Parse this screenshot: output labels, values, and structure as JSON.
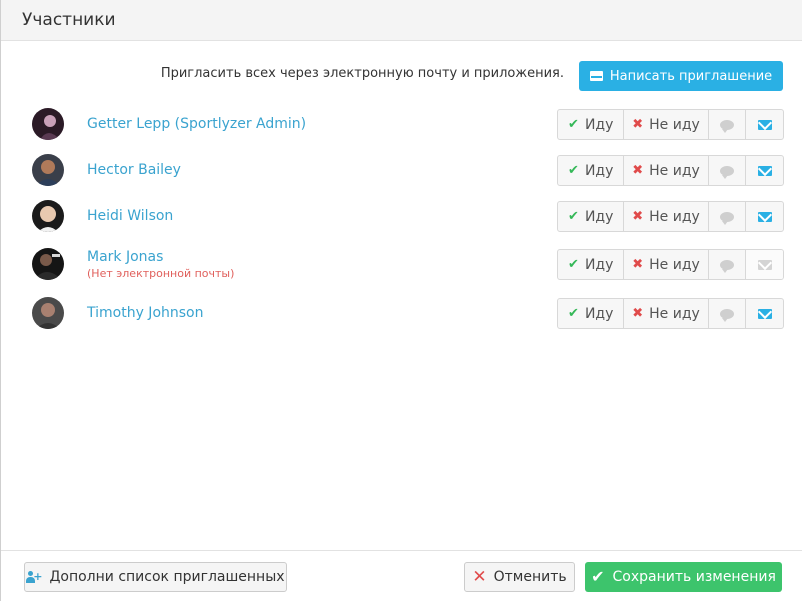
{
  "modal": {
    "title": "Участники"
  },
  "invite": {
    "text": "Пригласить всех через электронную почту и приложения.",
    "button_label": "Написать приглашение",
    "button_icon": "envelope-icon",
    "accent_color": "#2ab0e4"
  },
  "participants": [
    {
      "name": "Getter Lepp (Sportlyzer Admin)",
      "note": "",
      "go_label": "Иду",
      "nogo_label": "Не иду",
      "email_enabled": true
    },
    {
      "name": "Hector Bailey",
      "note": "",
      "go_label": "Иду",
      "nogo_label": "Не иду",
      "email_enabled": true
    },
    {
      "name": "Heidi Wilson",
      "note": "",
      "go_label": "Иду",
      "nogo_label": "Не иду",
      "email_enabled": true
    },
    {
      "name": "Mark Jonas",
      "note": "(Нет электронной почты)",
      "go_label": "Иду",
      "nogo_label": "Не иду",
      "email_enabled": false
    },
    {
      "name": "Timothy Johnson",
      "note": "",
      "go_label": "Иду",
      "nogo_label": "Не иду",
      "email_enabled": true
    }
  ],
  "footer": {
    "add_invitees_label": "Дополни список приглашенных",
    "cancel_label": "Отменить",
    "save_label": "Сохранить изменения",
    "save_color": "#3dc46c"
  }
}
